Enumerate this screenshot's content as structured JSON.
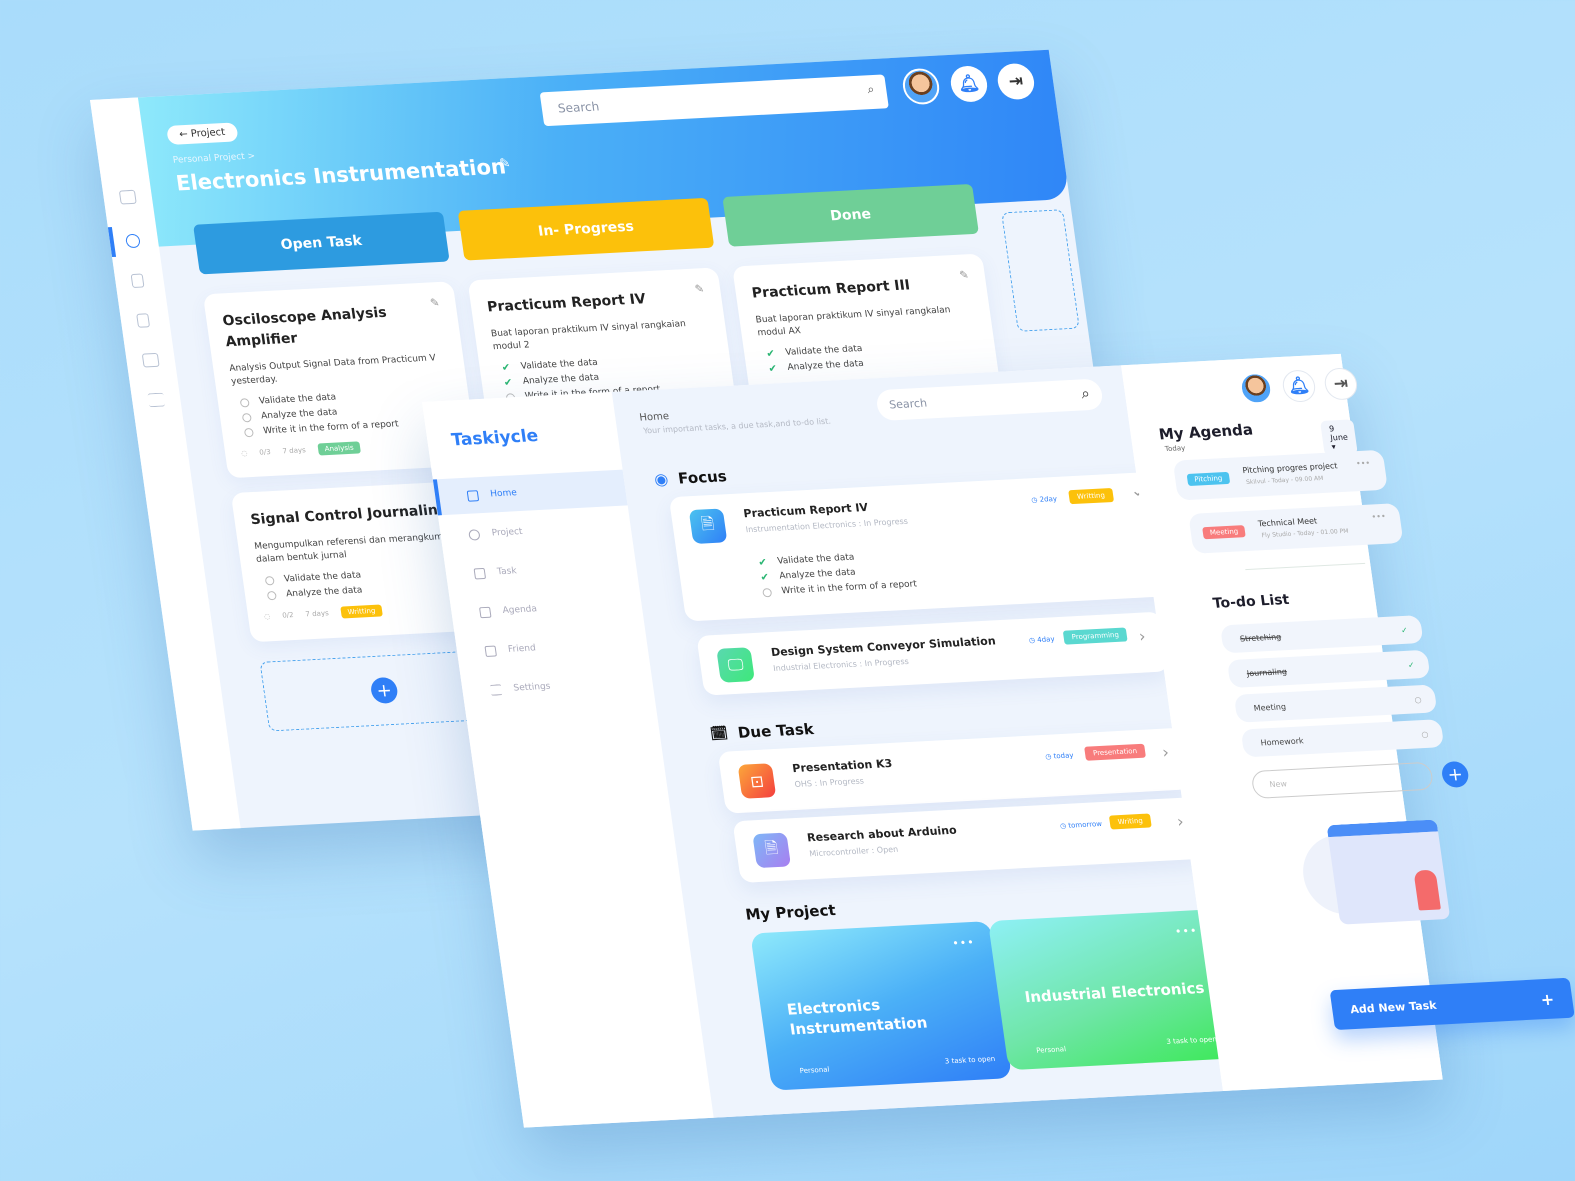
{
  "board": {
    "back_label": "Project",
    "breadcrumb": "Personal Project >",
    "title": "Electronics Instrumentation",
    "search_placeholder": "Search",
    "columns": [
      {
        "label": "Open Task",
        "color": "#2d9be0"
      },
      {
        "label": "In- Progress",
        "color": "#fcc10b"
      },
      {
        "label": "Done",
        "color": "#6fcf97"
      }
    ],
    "cards": [
      {
        "title": "Osciloscope Analysis Amplifier",
        "desc": "Analysis Output Signal Data from Practicum V yesterday.",
        "items": [
          {
            "text": "Validate the data",
            "done": false
          },
          {
            "text": "Analyze the data",
            "done": false
          },
          {
            "text": "Write it in the form of a report",
            "done": false
          }
        ],
        "progress": "0/3",
        "days": "7 days",
        "tag": "Analysis",
        "tag_color": "#6fcf97"
      },
      {
        "title": "Signal Control Journaling",
        "desc": "Mengumpulkan referensi dan merangkum dalam bentuk jurnal",
        "items": [
          {
            "text": "Validate the data",
            "done": false
          },
          {
            "text": "Analyze the data",
            "done": false
          }
        ],
        "progress": "0/2",
        "days": "7 days",
        "tag": "Writting",
        "tag_color": "#fcc10b"
      },
      {
        "title": "Practicum Report IV",
        "desc": "Buat laporan praktikum IV sinyal rangkaian modul 2",
        "items": [
          {
            "text": "Validate the data",
            "done": true
          },
          {
            "text": "Analyze the data",
            "done": true
          },
          {
            "text": "Write it in the form of a report",
            "done": false
          }
        ]
      },
      {
        "title": "Practicum Report III",
        "desc": "Buat laporan praktikum IV sinyal rangkalan modul AX",
        "items": [
          {
            "text": "Validate the data",
            "done": true
          },
          {
            "text": "Analyze the data",
            "done": true
          }
        ]
      }
    ]
  },
  "app": {
    "logo": "Taskiycle",
    "nav": [
      "Home",
      "Project",
      "Task",
      "Agenda",
      "Friend",
      "Settings"
    ],
    "header": {
      "title": "Home",
      "subtitle": "Your important tasks, a due task,and to-do list.",
      "search_placeholder": "Search"
    },
    "focus": {
      "title": "Focus",
      "tasks": [
        {
          "title": "Practicum Report IV",
          "sub": "Instrumentation Electronics : In Progress",
          "due": "2day",
          "tag": "Writting",
          "tag_color": "#fcc10b",
          "items": [
            {
              "text": "Validate the data",
              "done": true
            },
            {
              "text": "Analyze the data",
              "done": true
            },
            {
              "text": "Write it in the form of a report",
              "done": false
            }
          ]
        },
        {
          "title": "Design System Conveyor Simulation",
          "sub": "Industrial Electronics : In Progress",
          "due": "4day",
          "tag": "Programming",
          "tag_color": "#5ad8d0"
        }
      ]
    },
    "due": {
      "title": "Due Task",
      "tasks": [
        {
          "title": "Presentation K3",
          "sub": "OHS : In Progress",
          "due": "today",
          "tag": "Presentation",
          "tag_color": "#f87c7c"
        },
        {
          "title": "Research about Arduino",
          "sub": "Microcontroller : Open",
          "due": "tomorrow",
          "tag": "Writing",
          "tag_color": "#fcc10b"
        }
      ]
    },
    "projects": {
      "title": "My Project",
      "items": [
        {
          "name": "Electronics Instrumentation",
          "type": "Personal",
          "open": "3 task to open"
        },
        {
          "name": "Industrial Electronics",
          "type": "Personal",
          "open": "3 task to open"
        }
      ]
    },
    "agenda": {
      "title": "My Agenda",
      "sub": "Today",
      "date": "9 June",
      "items": [
        {
          "tag": "Pitching",
          "tag_color": "#4cc3ef",
          "title": "Pitching progres project",
          "meta": "Skilvul - Today - 09.00 AM"
        },
        {
          "tag": "Meeting",
          "tag_color": "#f87c7c",
          "title": "Technical Meet",
          "meta": "Fly Studio - Today - 01.00 PM"
        }
      ]
    },
    "todo": {
      "title": "To-do List",
      "items": [
        {
          "text": "Stretching",
          "done": true
        },
        {
          "text": "Journaling",
          "done": true
        },
        {
          "text": "Meeting",
          "done": false
        },
        {
          "text": "Homework",
          "done": false
        }
      ],
      "new_placeholder": "New"
    },
    "add_task": "Add New Task"
  }
}
